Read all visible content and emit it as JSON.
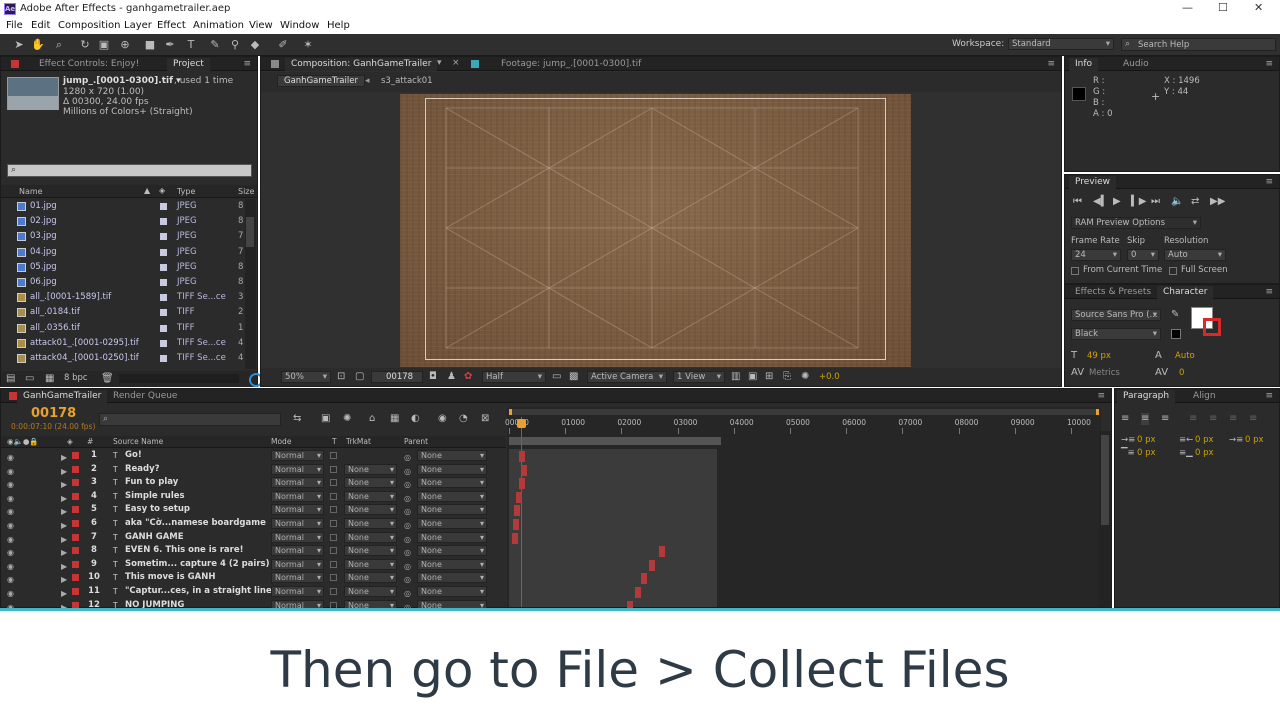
{
  "window": {
    "title": "Adobe After Effects - ganhgametrailer.aep",
    "app_icon": "Ae",
    "minimize": "—",
    "maximize": "☐",
    "close": "✕"
  },
  "menu": [
    "File",
    "Edit",
    "Composition",
    "Layer",
    "Effect",
    "Animation",
    "View",
    "Window",
    "Help"
  ],
  "toolbar": {
    "workspace_label": "Workspace:",
    "workspace_value": "Standard",
    "search_placeholder": "Search Help"
  },
  "project_panel": {
    "tabs": [
      "Effect Controls: Enjoy!",
      "Project"
    ],
    "item_name": "jump_.[0001-0300].tif ▾",
    "item_used": ", used 1 time",
    "item_lines": [
      "1280 x 720 (1.00)",
      "Δ 00300, 24.00 fps",
      "Millions of Colors+ (Straight)"
    ],
    "search_placeholder": "",
    "columns": [
      "Name",
      "Type",
      "Size"
    ],
    "rows": [
      {
        "name": "01.jpg",
        "type": "JPEG",
        "size": "8"
      },
      {
        "name": "02.jpg",
        "type": "JPEG",
        "size": "8"
      },
      {
        "name": "03.jpg",
        "type": "JPEG",
        "size": "7"
      },
      {
        "name": "04.jpg",
        "type": "JPEG",
        "size": "7"
      },
      {
        "name": "05.jpg",
        "type": "JPEG",
        "size": "8"
      },
      {
        "name": "06.jpg",
        "type": "JPEG",
        "size": "8"
      },
      {
        "name": "all_.[0001-1589].tif",
        "type": "TIFF Se...ce",
        "size": "3"
      },
      {
        "name": "all_.0184.tif",
        "type": "TIFF",
        "size": "2"
      },
      {
        "name": "all_.0356.tif",
        "type": "TIFF",
        "size": "1"
      },
      {
        "name": "attack01_.[0001-0295].tif",
        "type": "TIFF Se...ce",
        "size": "4"
      },
      {
        "name": "attack04_.[0001-0250].tif",
        "type": "TIFF Se...ce",
        "size": "4"
      }
    ],
    "bpc": "8 bpc"
  },
  "comp_panel": {
    "tabs": [
      "Composition: GanhGameTrailer",
      "Footage: jump_.[0001-0300].tif"
    ],
    "breadcrumbs": [
      "GanhGameTrailer",
      "s3_attack01"
    ],
    "zoom": "50%",
    "timecode": "00178",
    "resolution": "Half",
    "camera": "Active Camera",
    "view": "1 View",
    "exposure": "+0.0"
  },
  "info_panel": {
    "tabs": [
      "Info",
      "Audio"
    ],
    "r": "R :",
    "g": "G :",
    "b": "B :",
    "a": "A : 0",
    "x": "X : 1496",
    "y": "Y : 44"
  },
  "preview_panel": {
    "tab": "Preview",
    "options": "RAM Preview Options",
    "frame_rate_label": "Frame Rate",
    "skip_label": "Skip",
    "resolution_label": "Resolution",
    "frame_rate": "24",
    "skip": "0",
    "resolution": "Auto",
    "from_current": "From Current Time",
    "full_screen": "Full Screen"
  },
  "character_panel": {
    "tabs": [
      "Effects & Presets",
      "Character"
    ],
    "font": "Source Sans Pro (...",
    "style": "Black",
    "size": "49 px",
    "leading": "Auto",
    "kerning": "Metrics",
    "tracking": "0"
  },
  "paragraph_panel": {
    "tabs": [
      "Paragraph",
      "Align"
    ],
    "indent": [
      "0 px",
      "0 px",
      "0 px",
      "0 px",
      "0 px"
    ]
  },
  "timeline": {
    "tabs": [
      "GanhGameTrailer",
      "Render Queue"
    ],
    "timecode": "00178",
    "time_sub": "0:00:07:10 (24.00 fps)",
    "columns": [
      "#",
      "Source Name",
      "Mode",
      "T",
      "TrkMat",
      "Parent"
    ],
    "ruler": [
      "00000",
      "01000",
      "02000",
      "03000",
      "04000",
      "05000",
      "06000",
      "07000",
      "08000",
      "09000",
      "10000"
    ],
    "layers": [
      {
        "num": "1",
        "name": "Go!",
        "mode": "Normal",
        "trkmat": "",
        "parent": "None"
      },
      {
        "num": "2",
        "name": "Ready?",
        "mode": "Normal",
        "trkmat": "None",
        "parent": "None"
      },
      {
        "num": "3",
        "name": "Fun to play",
        "mode": "Normal",
        "trkmat": "None",
        "parent": "None"
      },
      {
        "num": "4",
        "name": "Simple rules",
        "mode": "Normal",
        "trkmat": "None",
        "parent": "None"
      },
      {
        "num": "5",
        "name": "Easy to setup",
        "mode": "Normal",
        "trkmat": "None",
        "parent": "None"
      },
      {
        "num": "6",
        "name": "aka \"Cờ...namese boardgame",
        "mode": "Normal",
        "trkmat": "None",
        "parent": "None"
      },
      {
        "num": "7",
        "name": "GANH GAME",
        "mode": "Normal",
        "trkmat": "None",
        "parent": "None"
      },
      {
        "num": "8",
        "name": "EVEN 6. This one is rare!",
        "mode": "Normal",
        "trkmat": "None",
        "parent": "None"
      },
      {
        "num": "9",
        "name": "Sometim... capture 4 (2 pairs)",
        "mode": "Normal",
        "trkmat": "None",
        "parent": "None"
      },
      {
        "num": "10",
        "name": "This move is GANH",
        "mode": "Normal",
        "trkmat": "None",
        "parent": "None"
      },
      {
        "num": "11",
        "name": "\"Captur...ces, in a straight line",
        "mode": "Normal",
        "trkmat": "None",
        "parent": "None"
      },
      {
        "num": "12",
        "name": "NO JUMPING",
        "mode": "Normal",
        "trkmat": "None",
        "parent": "None"
      }
    ]
  },
  "caption": "Then go to File > Collect Files",
  "colors": {
    "accent": "#41b7c3",
    "label_red": "#c63434",
    "timecode_orange": "#e8a030"
  }
}
